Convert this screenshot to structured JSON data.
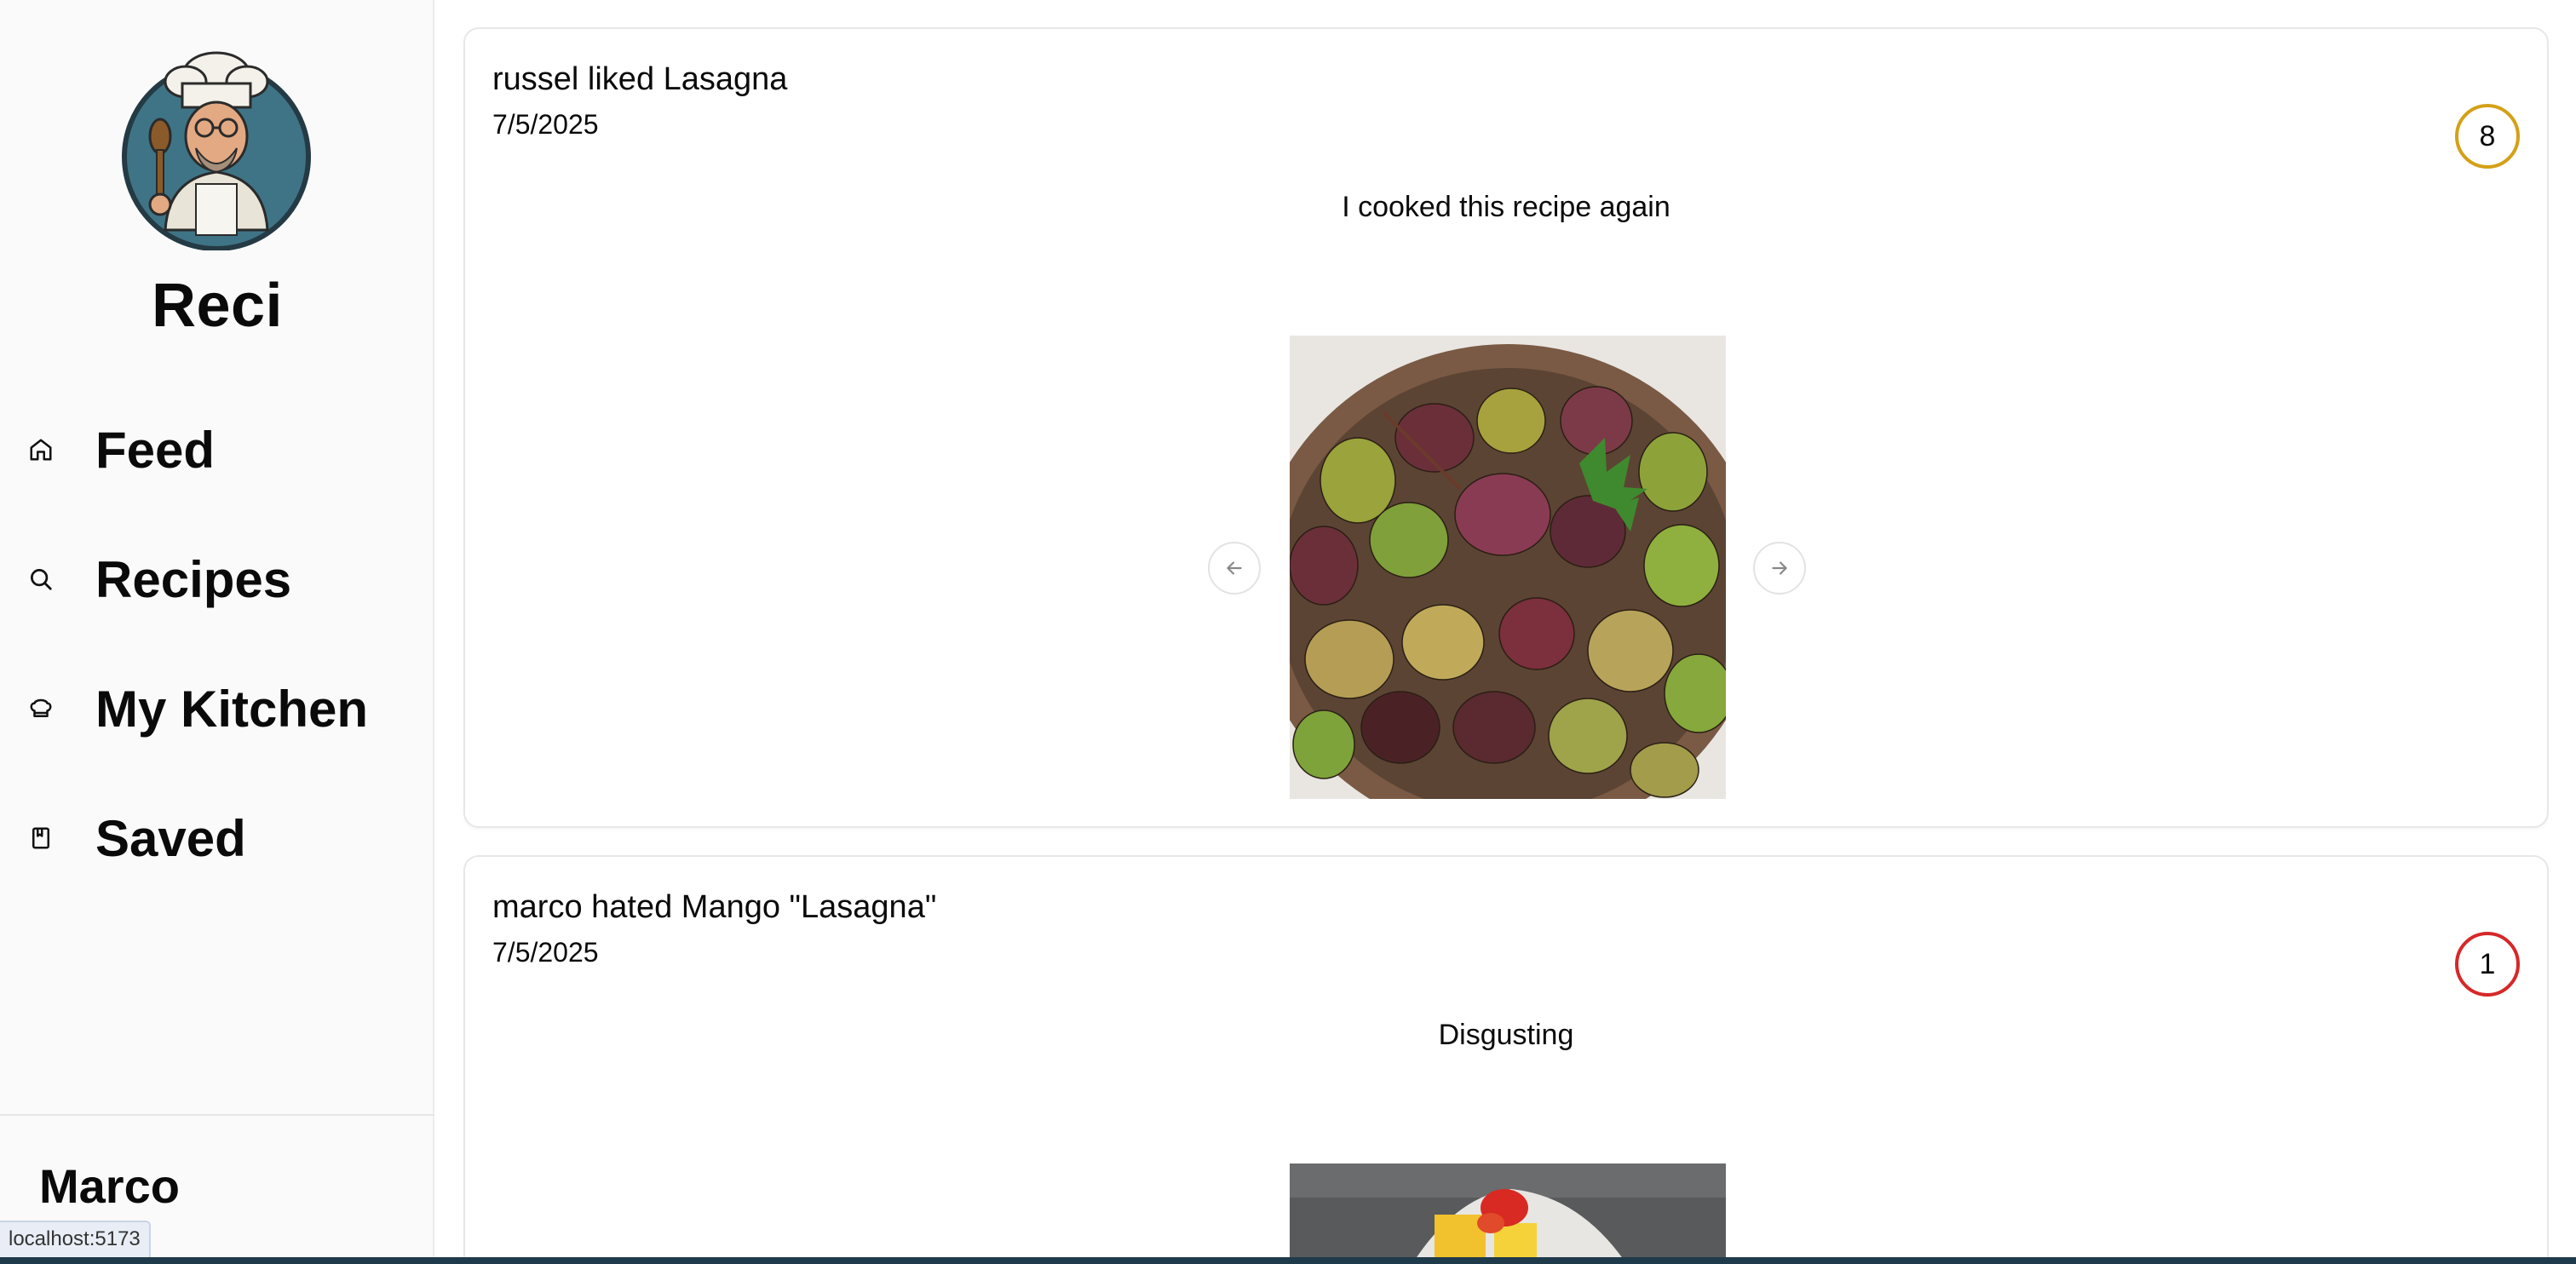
{
  "sidebar": {
    "brand": "Reci",
    "nav": [
      {
        "label": "Feed",
        "icon": "home-icon"
      },
      {
        "label": "Recipes",
        "icon": "search-icon"
      },
      {
        "label": "My Kitchen",
        "icon": "chef-hat-icon"
      },
      {
        "label": "Saved",
        "icon": "book-icon"
      }
    ],
    "user_name": "Marco"
  },
  "status_bar": {
    "url": "localhost:5173"
  },
  "feed": {
    "posts": [
      {
        "title": "russel liked Lasagna",
        "date": "7/5/2025",
        "rating": "8",
        "rating_color": "#d4a017",
        "comment": "I cooked this recipe again"
      },
      {
        "title": "marco hated Mango \"Lasagna\"",
        "date": "7/5/2025",
        "rating": "1",
        "rating_color": "#d62828",
        "comment": "Disgusting"
      }
    ]
  },
  "colors": {
    "accent_dark": "#1f3a4a",
    "sidebar_bg": "#fafafa"
  }
}
